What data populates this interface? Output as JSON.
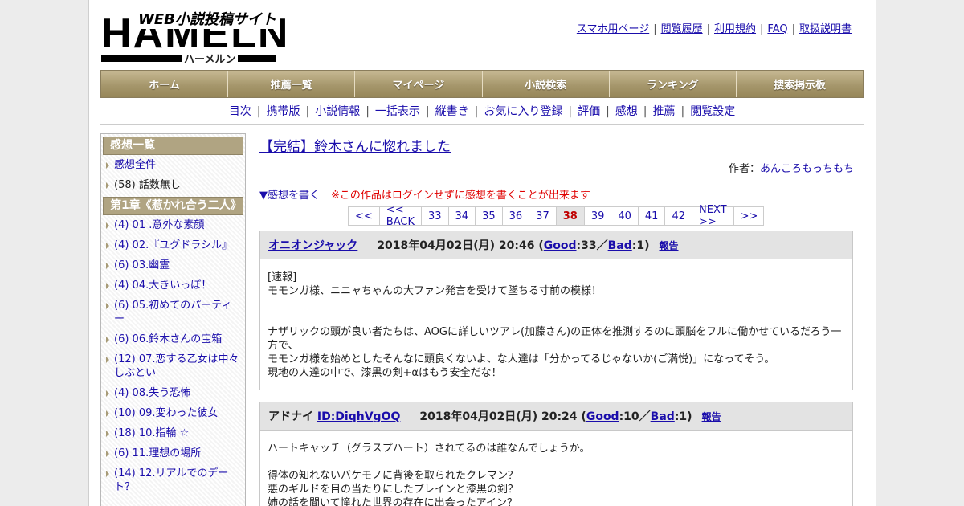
{
  "header": {
    "logo_text": "HAMELN",
    "logo_tagline": "WEB小説投稿サイト",
    "logo_sub": "ハーメルン",
    "links": [
      "スマホ用ページ",
      "閲覧履歴",
      "利用規約",
      "FAQ",
      "取扱説明書"
    ]
  },
  "main_nav": [
    "ホーム",
    "推薦一覧",
    "マイページ",
    "小説検索",
    "ランキング",
    "捜索掲示板"
  ],
  "sub_nav": [
    "目次",
    "携帯版",
    "小説情報",
    "一括表示",
    "縦書き",
    "お気に入り登録",
    "評価",
    "感想",
    "推薦",
    "閲覧設定"
  ],
  "sidebar": {
    "head1": "感想一覧",
    "all_label": "感想全件",
    "no_episode": "(58) 話数無し",
    "chapter": "第1章《惹かれ合う二人》",
    "items": [
      "(4) 01 .意外な素顔",
      "(4) 02.『ユグドラシル』",
      "(6) 03.幽霊",
      "(4) 04.大きいっぽ！",
      "(6) 05.初めてのパーティー",
      "(6) 06.鈴木さんの宝箱",
      "(12) 07.恋する乙女は中々しぶとい",
      "(4) 08.失う恐怖",
      "(10) 09.変わった彼女",
      "(18) 10.指輪 ☆",
      "(6) 11.理想の場所",
      "(14) 12.リアルでのデート？"
    ]
  },
  "content": {
    "title": "【完結】鈴木さんに惚れました",
    "author_label": "作者：",
    "author": "あんころもっちもち",
    "write_link": "▼感想を書く",
    "warning": "※この作品はログインせずに感想を書くことが出来ます",
    "pager": [
      "<<",
      "<< BACK",
      "33",
      "34",
      "35",
      "36",
      "37",
      "38",
      "39",
      "40",
      "41",
      "42",
      "NEXT >>",
      ">>"
    ],
    "current_page": "38"
  },
  "reviews": [
    {
      "name": "オニオンジャック",
      "id": "",
      "date": "2018年04月02日(月) 20:46",
      "good_label": "Good",
      "good_count": ":33／",
      "bad_label": "Bad",
      "bad_count": ":1)",
      "open_paren": " (",
      "report": "報告",
      "lines": [
        "[速報]",
        "モモンガ様、ニニャちゃんの大ファン発言を受けて墜ちる寸前の模様！",
        "ナザリックの頭が良い者たちは、AOGに詳しいツアレ(加藤さん)の正体を推測するのに頭脳をフルに働かせているだろう一方で、",
        "モモンガ様を始めとしたそんなに頭良くないよ、な人達は「分かってるじゃないか(ご満悦)」になってそう。",
        "現地の人達の中で、漆黒の剣+αはもう安全だな！"
      ]
    },
    {
      "name": "アドナイ",
      "id": "ID:DiqhVgOQ",
      "date": "2018年04月02日(月) 20:24",
      "good_label": "Good",
      "good_count": ":10／",
      "bad_label": "Bad",
      "bad_count": ":1)",
      "open_paren": " (",
      "report": "報告",
      "lines": [
        "ハートキャッチ（グラスプハート）されてるのは誰なんでしょうか。",
        "得体の知れないバケモノに背後を取られたクレマン？",
        "悪のギルドを目の当たりにしたブレインと漆黒の剣？",
        "姉の話を聞いて憧れた世界の存在に出会ったアイン？"
      ]
    }
  ]
}
